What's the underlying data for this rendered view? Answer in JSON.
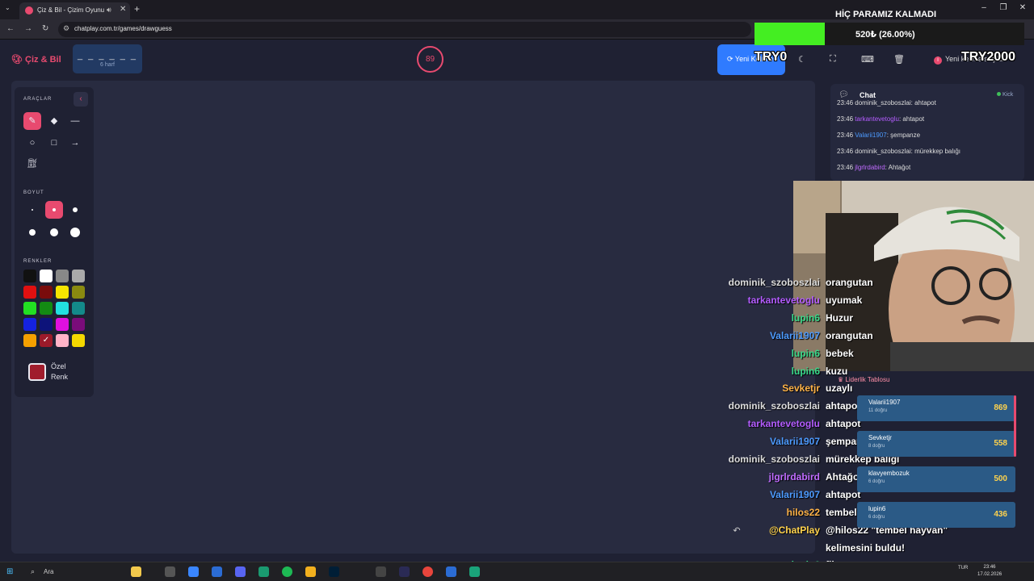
{
  "browser": {
    "tab_title": "Çiz & Bil - Çizim Oyunu",
    "url": "chatplay.com.tr/games/drawguess"
  },
  "app": {
    "logo": "Çiz & Bil",
    "word_mask": "_ _ _ _ _ _",
    "word_hint": "6 harf",
    "timer": "89",
    "new_word_button": "Yeni Kelime",
    "selected_badge": "Yeni kelime seçildi"
  },
  "tools": {
    "section_tools": "ARAÇLAR",
    "section_size": "BOYUT",
    "section_colors": "RENKLER",
    "custom_color_label_1": "Özel",
    "custom_color_label_2": "Renk",
    "palette": [
      "#111111",
      "#ffffff",
      "#888888",
      "#aaaaaa",
      "#e01010",
      "#7a0c0c",
      "#f5e400",
      "#8a8a10",
      "#22e022",
      "#138a13",
      "#22e0e0",
      "#138a8a",
      "#1522e0",
      "#0d137a",
      "#e010e0",
      "#7a0c7a",
      "#f5a000",
      "#9b1a2a",
      "#ffb3c8",
      "#f5d800"
    ],
    "custom_color": "#a01c2c"
  },
  "chat": {
    "title": "Chat",
    "kick_label": "Kick",
    "messages": [
      {
        "time": "23:46",
        "user": "dominik_szoboszlai",
        "text": "ahtapot",
        "color": "#dddddd"
      },
      {
        "time": "23:46",
        "user": "tarkantevetoglu",
        "text": "ahtapot",
        "color": "#b45cff"
      },
      {
        "time": "23:46",
        "user": "Valarii1907",
        "text": "şempanze",
        "color": "#4d9bff"
      },
      {
        "time": "23:46",
        "user": "dominik_szoboszlai",
        "text": "mürekkep balığı",
        "color": "#dddddd"
      },
      {
        "time": "23:46",
        "user": "jlgrlrdabird",
        "text": "Ahtağot",
        "color": "#c06cff"
      }
    ]
  },
  "stream": {
    "donation_title": "HİÇ PARAMIZ KALMADI",
    "donation_progress_text": "520₺ (26.00%)",
    "donation_progress": 0.26,
    "try_left": "TRY0",
    "try_right": "TRY2000",
    "leaderboard_title": "Liderlik Tablosu",
    "leaderboard": [
      {
        "name": "Valarii1907",
        "count": "11 doğru",
        "score": "869"
      },
      {
        "name": "Sevketjr",
        "count": "8 doğru",
        "score": "558"
      },
      {
        "name": "klavyembozuk",
        "count": "6 doğru",
        "score": "500"
      },
      {
        "name": "lupin6",
        "count": "6 doğru",
        "score": "436"
      }
    ],
    "overlay_chat": [
      {
        "user": "dominik_szoboszlai",
        "text": "orangutan",
        "color": "#dcdcdc"
      },
      {
        "user": "tarkantevetoglu",
        "text": "uyumak",
        "color": "#b45cff"
      },
      {
        "user": "lupin6",
        "text": "Huzur",
        "color": "#39d98a"
      },
      {
        "user": "Valarii1907",
        "text": "orangutan",
        "color": "#4d9bff"
      },
      {
        "user": "lupin6",
        "text": "bebek",
        "color": "#39d98a"
      },
      {
        "user": "lupin6",
        "text": "kuzu",
        "color": "#39d98a"
      },
      {
        "user": "Sevketjr",
        "text": "uzaylı",
        "color": "#ffb347"
      },
      {
        "user": "dominik_szoboszlai",
        "text": "ahtapot",
        "color": "#dcdcdc"
      },
      {
        "user": "tarkantevetoglu",
        "text": "ahtapot",
        "color": "#b45cff"
      },
      {
        "user": "Valarii1907",
        "text": "şempanze",
        "color": "#4d9bff"
      },
      {
        "user": "dominik_szoboszlai",
        "text": "mürekkep balığı",
        "color": "#dcdcdc"
      },
      {
        "user": "jlgrlrdabird",
        "text": "Ahtağot",
        "color": "#c06cff"
      },
      {
        "user": "Valarii1907",
        "text": "ahtapot",
        "color": "#4d9bff"
      },
      {
        "user": "hilos22",
        "text": "tembel hayvan",
        "color": "#ffb347"
      },
      {
        "user": "@ChatPlay",
        "text": "@hilos22 \"tembel hayvan\"",
        "color": "#ffd34d"
      },
      {
        "user": "",
        "text": "kelimesini buldu!",
        "color": "#ffffff"
      },
      {
        "user": "lupin6",
        "text": "fil",
        "color": "#39d98a"
      }
    ]
  },
  "taskbar": {
    "search_label": "Ara",
    "lang": "TUR",
    "time": "23:46",
    "date": "17.02.2026"
  }
}
